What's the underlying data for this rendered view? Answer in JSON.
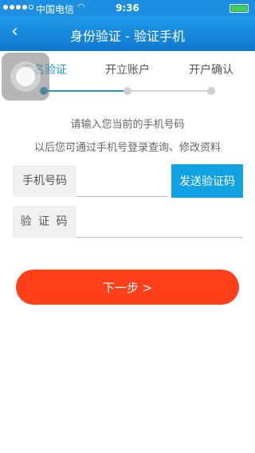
{
  "status_bar": {
    "carrier": "中国电信",
    "time": "9:36"
  },
  "nav": {
    "back_icon": "‹",
    "title": "身份验证 - 验证手机"
  },
  "steps": {
    "items": [
      {
        "label": "实名验证",
        "active": true
      },
      {
        "label": "开立账户",
        "active": false
      },
      {
        "label": "开户确认",
        "active": false
      }
    ]
  },
  "hints": {
    "line1": "请输入您当前的手机号码",
    "line2": "以后您可通过手机号登录查询、修改资料"
  },
  "form": {
    "phone_label": "手机号码",
    "phone_value": "",
    "code_label": "验 证 码",
    "code_value": "",
    "send_code_label": "发送验证码"
  },
  "next_button_label": "下一步 >",
  "colors": {
    "nav": "#1a8ae0",
    "accent": "#10a2e2",
    "primary_button": "#ff4019"
  }
}
